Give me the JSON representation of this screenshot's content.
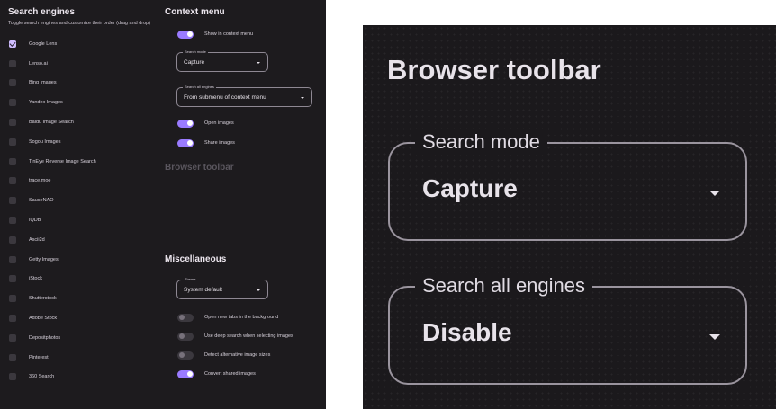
{
  "search_engines": {
    "title": "Search engines",
    "description": "Toggle search engines and customize their order (drag and drop)",
    "items": [
      {
        "label": "Google Lens",
        "checked": true
      },
      {
        "label": "Lenso.ai",
        "checked": false
      },
      {
        "label": "Bing Images",
        "checked": false
      },
      {
        "label": "Yandex Images",
        "checked": false
      },
      {
        "label": "Baidu Image Search",
        "checked": false
      },
      {
        "label": "Sogou Images",
        "checked": false
      },
      {
        "label": "TinEye Reverse Image Search",
        "checked": false
      },
      {
        "label": "trace.moe",
        "checked": false
      },
      {
        "label": "SauceNAO",
        "checked": false
      },
      {
        "label": "IQDB",
        "checked": false
      },
      {
        "label": "Ascii2d",
        "checked": false
      },
      {
        "label": "Getty Images",
        "checked": false
      },
      {
        "label": "iStock",
        "checked": false
      },
      {
        "label": "Shutterstock",
        "checked": false
      },
      {
        "label": "Adobe Stock",
        "checked": false
      },
      {
        "label": "Depositphotos",
        "checked": false
      },
      {
        "label": "Pinterest",
        "checked": false
      },
      {
        "label": "360 Search",
        "checked": false
      }
    ]
  },
  "context_menu": {
    "title": "Context menu",
    "show_in_context_menu": {
      "label": "Show in context menu",
      "on": true
    },
    "search_mode": {
      "legend": "Search mode",
      "value": "Capture"
    },
    "search_all_engines": {
      "legend": "Search all engines",
      "value": "From submenu of context menu"
    },
    "open_images": {
      "label": "Open images",
      "on": true
    },
    "share_images": {
      "label": "Share images",
      "on": true
    }
  },
  "browser_toolbar": {
    "title": "Browser toolbar"
  },
  "miscellaneous": {
    "title": "Miscellaneous",
    "theme": {
      "legend": "Theme",
      "value": "System default"
    },
    "toggles": [
      {
        "label": "Open new tabs in the background",
        "on": false
      },
      {
        "label": "Use deep search when selecting images",
        "on": false
      },
      {
        "label": "Detect alternative image sizes",
        "on": false
      },
      {
        "label": "Convert shared images",
        "on": true
      }
    ]
  },
  "zoom": {
    "title": "Browser toolbar",
    "search_mode": {
      "legend": "Search mode",
      "value": "Capture"
    },
    "search_all_engines": {
      "legend": "Search all engines",
      "value": "Disable"
    }
  },
  "colors": {
    "background": "#1d1b1e",
    "accent": "#9a7bff",
    "checkbox_checked": "#cfbcff"
  }
}
